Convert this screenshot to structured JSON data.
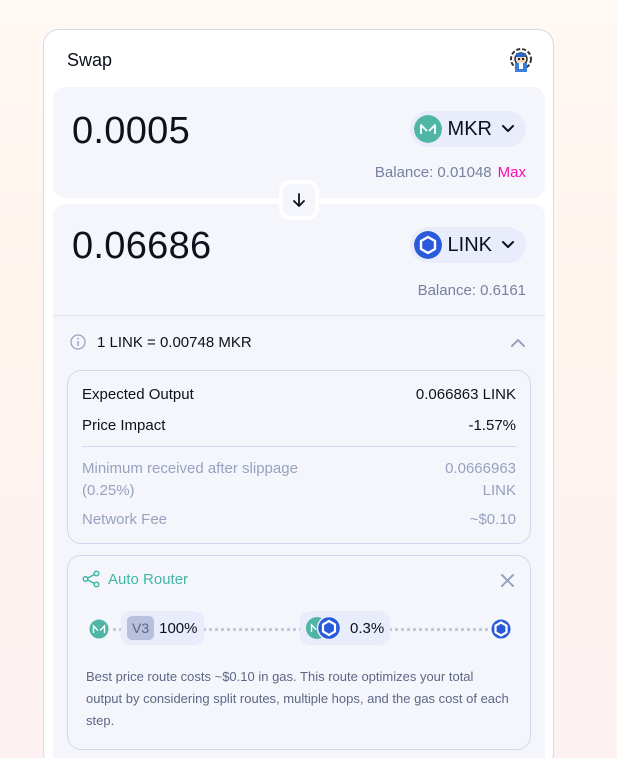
{
  "swap": {
    "title": "Swap",
    "settings_icon": "settings-gear-icon"
  },
  "input": {
    "amount": "0.0005",
    "token_symbol": "MKR",
    "token_color": "#4fb5a4",
    "balance_label": "Balance: 0.01048",
    "max_label": "Max"
  },
  "output": {
    "amount": "0.06686",
    "token_symbol": "LINK",
    "token_color": "#2a5ada",
    "balance_label": "Balance: 0.6161"
  },
  "details": {
    "rate": "1 LINK = 0.00748 MKR",
    "expected_output_label": "Expected Output",
    "expected_output_value": "0.066863 LINK",
    "price_impact_label": "Price Impact",
    "price_impact_value": "-1.57%",
    "min_received_label": "Minimum received after slippage (0.25%)",
    "min_received_value_line1": "0.0666963",
    "min_received_value_line2": "LINK",
    "network_fee_label": "Network Fee",
    "network_fee_value": "~$0.10"
  },
  "router": {
    "title": "Auto Router",
    "pool_version": "V3",
    "split_percent": "100%",
    "fee_tier": "0.3%",
    "note": "Best price route costs ~$0.10 in gas. This route optimizes your total output by considering split routes, multiple hops, and the gas cost of each step."
  },
  "colors": {
    "accent_pink": "#fc0cac",
    "router_teal": "#40b6a6",
    "panel_bg": "#f5f6fc"
  }
}
